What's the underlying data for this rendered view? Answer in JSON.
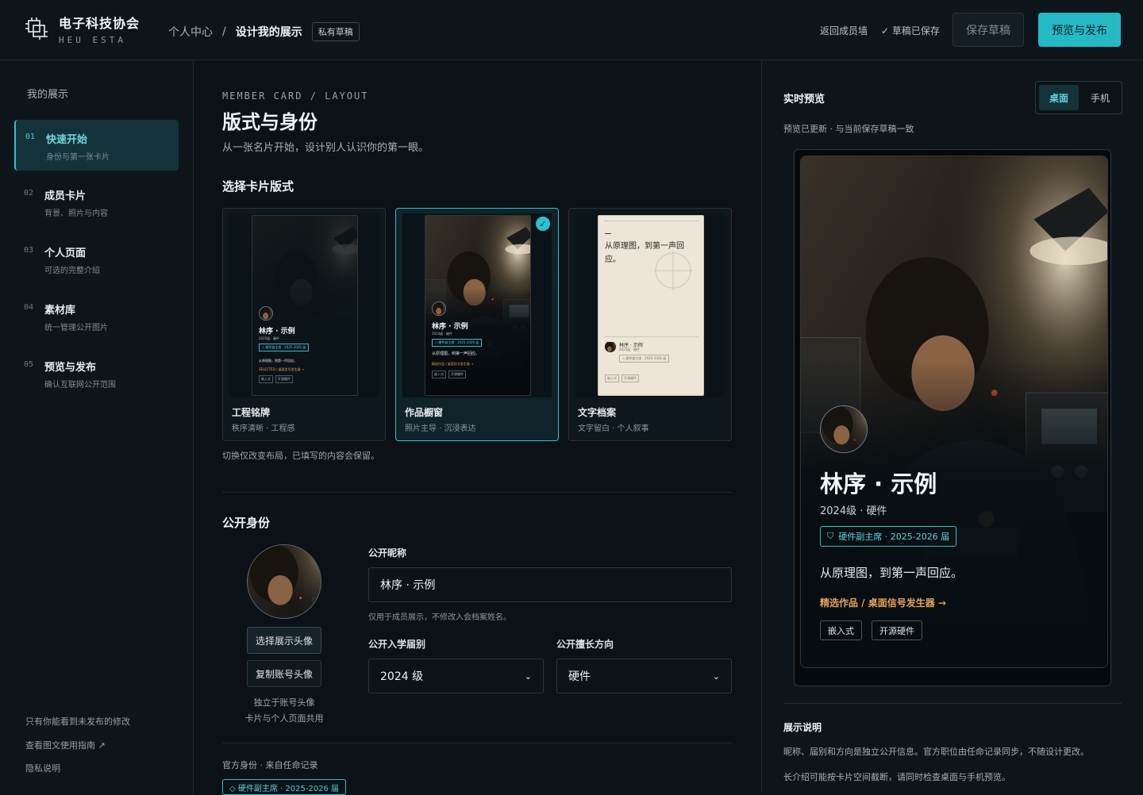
{
  "header": {
    "brand_cn": "电子科技协会",
    "brand_en": "HEU ESTA",
    "breadcrumb_root": "个人中心",
    "breadcrumb_sep": "/",
    "breadcrumb_current": "设计我的展示",
    "status_pill": "私有草稿",
    "back_link": "返回成员墙",
    "saved_status": "✓ 草稿已保存",
    "save_draft": "保存草稿",
    "publish": "预览与发布"
  },
  "sidebar": {
    "title": "我的展示",
    "items": [
      {
        "num": "01",
        "title": "快速开始",
        "sub": "身份与第一张卡片",
        "active": true
      },
      {
        "num": "02",
        "title": "成员卡片",
        "sub": "背景、照片与内容"
      },
      {
        "num": "03",
        "title": "个人页面",
        "sub": "可选的完整介绍"
      },
      {
        "num": "04",
        "title": "素材库",
        "sub": "统一管理公开图片"
      },
      {
        "num": "05",
        "title": "预览与发布",
        "sub": "确认互联网公开范围"
      }
    ],
    "footer": [
      "只有你能看到未发布的修改",
      "查看图文使用指南 ↗",
      "隐私说明"
    ]
  },
  "main": {
    "eyebrow": "MEMBER CARD / LAYOUT",
    "title": "版式与身份",
    "lead": "从一张名片开始，设计别人认识你的第一眼。",
    "layout_heading": "选择卡片版式",
    "layouts": [
      {
        "name": "工程铭牌",
        "sub": "秩序清晰 · 工程感"
      },
      {
        "name": "作品橱窗",
        "sub": "照片主导 · 沉浸表达",
        "selected": true
      },
      {
        "name": "文字档案",
        "sub": "文字留白 · 个人叙事"
      }
    ],
    "layout_note": "切换仅改变布局，已填写的内容会保留。",
    "identity_heading": "公开身份",
    "avatar_choose": "选择展示头像",
    "avatar_copy": "复制账号头像",
    "avatar_hint_1": "独立于账号头像",
    "avatar_hint_2": "卡片与个人页面共用",
    "nickname_label": "公开昵称",
    "nickname_value": "林序 · 示例",
    "nickname_hint": "仅用于成员展示，不修改入会档案姓名。",
    "year_label": "公开入学届别",
    "year_value": "2024 级",
    "dir_label": "公开擅长方向",
    "dir_value": "硬件",
    "official_label": "官方身份 · 来自任命记录",
    "official_tag": "◇ 硬件副主席 · 2025-2026 届"
  },
  "preview": {
    "title": "实时预览",
    "seg_desktop": "桌面",
    "seg_mobile": "手机",
    "status": "预览已更新 · 与当前保存草稿一致",
    "card": {
      "name": "林序 · 示例",
      "meta": "2024级 · 硬件",
      "role": "硬件副主席 · 2025-2026 届",
      "quote": "从原理图，到第一声回应。",
      "link": "精选作品 / 桌面信号发生器 →",
      "tags": [
        "嵌入式",
        "开源硬件"
      ]
    },
    "explain_title": "展示说明",
    "explain_lines": [
      "昵称、届别和方向是独立公开信息。官方职位由任命记录同步，不随设计更改。",
      "长介绍可能按卡片空间截断，请同时检查桌面与手机预览。"
    ]
  },
  "mini_cards": {
    "a_name": "林序 · 示例",
    "a_meta": "2025届 · 硬件",
    "a_role": "◇ 硬件副主席 · 2025-2026 届",
    "a_quote": "从原理图，到第一声回应。",
    "a_link": "SELECTED / 桌面信号发生器 →",
    "a_tags": [
      "嵌入式",
      "开源硬件"
    ],
    "b_name": "林序 · 示例",
    "b_meta": "2024级 · 硬件",
    "b_role": "◇ 硬件副主席 · 2025-2026 届",
    "b_quote": "从原理图，到第一声回应。",
    "b_link": "精选作品 / 桌面信号发生器 →",
    "b_tags": [
      "嵌入式",
      "开源硬件"
    ],
    "c_title": "从原理图，到第一声回应。",
    "c_name": "林序 · 示例",
    "c_meta": "2025届 · 硬件",
    "c_role": "◇ 硬件副主席 · 2025-2026 届",
    "c_tags": [
      "嵌入式",
      "开源硬件"
    ]
  },
  "colors": {
    "accent": "#25b9c6",
    "link": "#e5a25b",
    "bg": "#0b1116"
  }
}
